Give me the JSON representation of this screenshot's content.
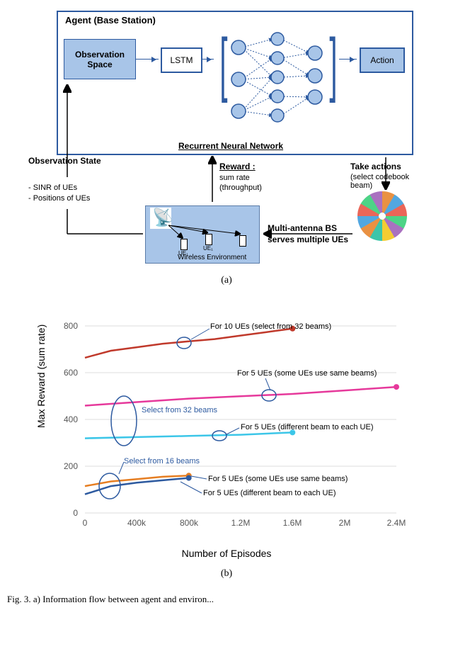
{
  "diagram_a": {
    "agent_title": "Agent (Base Station)",
    "obs_box": "Observation Space",
    "lstm": "LSTM",
    "action": "Action",
    "rnn_label": "Recurrent Neural Network",
    "obs_state_label": "Observation State",
    "obs_items_1": "- SINR of UEs",
    "obs_items_2": "- Positions of UEs",
    "reward_label": "Reward :",
    "reward_items_1": "sum rate",
    "reward_items_2": "(throughput)",
    "take_actions_label": "Take actions",
    "take_actions_items": "(select codebook beam)",
    "env_title": "Wireless Environment",
    "env_label_right_1": "Multi-antenna BS",
    "env_label_right_2": "serves multiple UEs",
    "ue1": "UE₁",
    "ue2": "UE₁",
    "subfig": "(a)"
  },
  "chart_b": {
    "ylabel": "Max Reward (sum rate)",
    "xlabel": "Number of Episodes",
    "subfig": "(b)",
    "anno_32": "Select from 32 beams",
    "anno_16": "Select from 16 beams",
    "s1": "For 10 UEs (select from 32 beams)",
    "s2": "For 5 UEs (some UEs use same beams)",
    "s3": "For 5 UEs (different beam to each UE)",
    "s4": "For 5 UEs (some UEs use same beams)",
    "s5": "For 5 UEs (different beam to each UE)"
  },
  "caption": "Fig. 3. a) Information flow between agent and environ...",
  "chart_data": {
    "type": "line",
    "xlabel": "Number of Episodes",
    "ylabel": "Max Reward (sum rate)",
    "xlim": [
      0,
      2400000
    ],
    "ylim": [
      0,
      850
    ],
    "xticks": [
      0,
      400000,
      800000,
      1200000,
      1600000,
      2000000,
      2400000
    ],
    "xtick_labels": [
      "0",
      "400k",
      "800k",
      "1.2M",
      "1.6M",
      "2M",
      "2.4M"
    ],
    "yticks": [
      0,
      200,
      400,
      600,
      800
    ],
    "series": [
      {
        "name": "For 10 UEs (select from 32 beams)",
        "color": "#c0392b",
        "x": [
          0,
          200000,
          400000,
          600000,
          800000,
          1000000,
          1200000,
          1400000,
          1600000
        ],
        "y": [
          665,
          695,
          710,
          725,
          735,
          745,
          760,
          775,
          790
        ]
      },
      {
        "name": "For 5 UEs (some UEs use same beams) — 32 beams",
        "color": "#e6399b",
        "x": [
          0,
          400000,
          800000,
          1200000,
          1600000,
          2000000,
          2400000
        ],
        "y": [
          460,
          475,
          490,
          500,
          510,
          525,
          540
        ]
      },
      {
        "name": "For 5 UEs (different beam to each UE) — 32 beams",
        "color": "#3cc6e8",
        "x": [
          0,
          400000,
          800000,
          1200000,
          1600000
        ],
        "y": [
          320,
          325,
          330,
          335,
          345
        ]
      },
      {
        "name": "For 5 UEs (some UEs use same beams) — 16 beams",
        "color": "#e67e22",
        "x": [
          0,
          200000,
          400000,
          600000,
          800000
        ],
        "y": [
          115,
          135,
          145,
          155,
          160
        ]
      },
      {
        "name": "For 5 UEs (different beam to each UE) — 16 beams",
        "color": "#2d5aa0",
        "x": [
          0,
          200000,
          400000,
          600000,
          800000
        ],
        "y": [
          80,
          115,
          130,
          140,
          150
        ]
      }
    ],
    "annotations": [
      {
        "text": "Select from 32 beams",
        "points_to_series": [
          1,
          2
        ]
      },
      {
        "text": "Select from 16 beams",
        "points_to_series": [
          3,
          4
        ]
      }
    ]
  }
}
